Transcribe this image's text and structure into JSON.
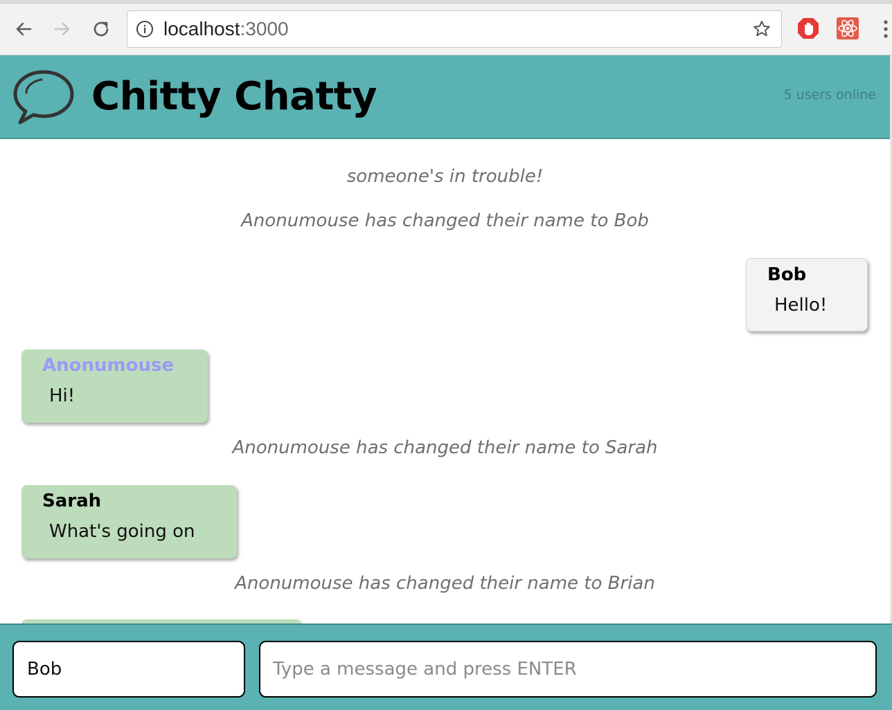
{
  "browser": {
    "url_host": "localhost",
    "url_port": ":3000",
    "icons": {
      "back": "back-arrow-icon",
      "forward": "forward-arrow-icon",
      "reload": "reload-icon",
      "info": "info-icon",
      "bookmark": "star-icon",
      "ext_stop": "stop-hand-icon",
      "ext_react": "react-devtools-icon",
      "menu": "kebab-menu-icon"
    }
  },
  "header": {
    "title": "Chitty Chatty",
    "users_online": "5 users online",
    "logo_icon": "speech-bubble-icon"
  },
  "messages": [
    {
      "type": "system",
      "text": "someone's in trouble!"
    },
    {
      "type": "system",
      "text": "Anonumouse has changed their name to Bob"
    },
    {
      "type": "chat",
      "own": true,
      "username": "Bob",
      "username_color": "#000000",
      "text": "Hello!"
    },
    {
      "type": "chat",
      "own": false,
      "username": "Anonumouse",
      "username_color": "#9b9bf5",
      "text": "Hi!"
    },
    {
      "type": "system",
      "text": "Anonumouse has changed their name to Sarah"
    },
    {
      "type": "chat",
      "own": false,
      "username": "Sarah",
      "username_color": "#000000",
      "text": "What's going on"
    },
    {
      "type": "system",
      "text": "Anonumouse has changed their name to Brian"
    }
  ],
  "composer": {
    "username_value": "Bob",
    "message_placeholder": "Type a message and press ENTER"
  },
  "colors": {
    "header_bg": "#5bb2b2",
    "own_bubble": "#f3f3f3",
    "other_bubble": "#bddcbb",
    "system_text": "#6f6f6f",
    "anon_name": "#9b9bf5"
  }
}
